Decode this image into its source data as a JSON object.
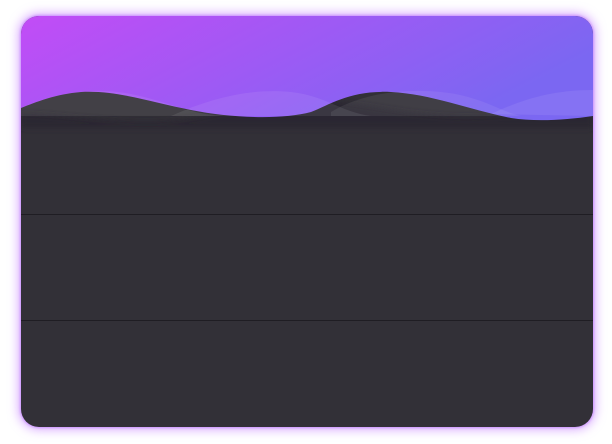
{
  "card": {
    "header": {
      "title": "",
      "gradient_start": "#c24cf6",
      "gradient_end": "#7b67f2"
    },
    "rows": [
      {
        "text": ""
      },
      {
        "text": ""
      },
      {
        "text": ""
      }
    ],
    "background": "#323037",
    "divider_color": "#1f1d23",
    "glow_color": "#b86cff"
  }
}
